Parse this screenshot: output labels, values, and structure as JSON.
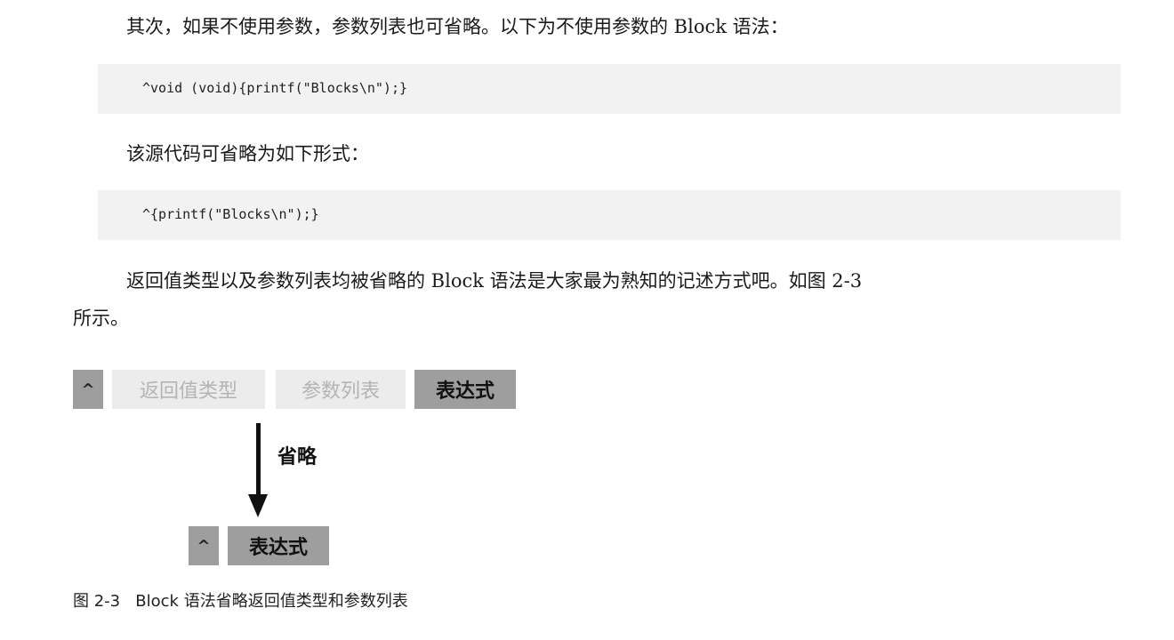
{
  "paragraphs": {
    "p1": "其次，如果不使用参数，参数列表也可省略。以下为不使用参数的 Block 语法：",
    "p2": "该源代码可省略为如下形式：",
    "p3_line1": "返回值类型以及参数列表均被省略的 Block 语法是大家最为熟知的记述方式吧。如图 2-3",
    "p3_line2": "所示。"
  },
  "code": {
    "snippet1": "^void (void){printf(\"Blocks\\n\");}",
    "snippet2": "^{printf(\"Blocks\\n\");}"
  },
  "figure": {
    "full_syntax": {
      "caret": "^",
      "return_type": "返回值类型",
      "param_list": "参数列表",
      "expression": "表达式"
    },
    "arrow_label": "省略",
    "short_syntax": {
      "caret": "^",
      "expression": "表达式"
    },
    "caption": "图 2-3   Block 语法省略返回值类型和参数列表"
  }
}
